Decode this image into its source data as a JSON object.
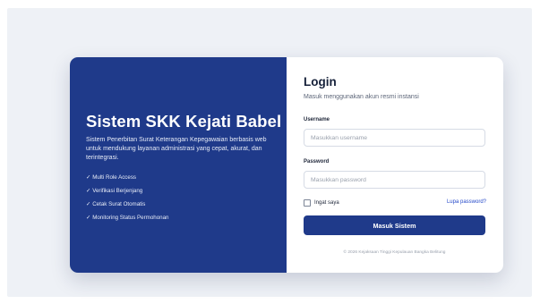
{
  "brand": {
    "title": "Sistem SKK Kejati Babel",
    "description": "Sistem Penerbitan Surat Keterangan Kepegawaian berbasis web untuk mendukung layanan administrasi yang cepat, akurat, dan terintegrasi.",
    "features": [
      "Multi Role Access",
      "Verifikasi Berjenjang",
      "Cetak Surat Otomatis",
      "Monitoring Status Permohonan"
    ],
    "check_glyph": "✓"
  },
  "login": {
    "title": "Login",
    "subtitle": "Masuk menggunakan akun resmi instansi",
    "username_label": "Username",
    "username_placeholder": "Masukkan username",
    "username_value": "",
    "password_label": "Password",
    "password_placeholder": "Masukkan password",
    "password_value": "",
    "remember_label": "Ingat saya",
    "remember_checked": false,
    "forgot_label": "Lupa password?",
    "submit_label": "Masuk Sistem",
    "footer": "© 2026 Kejaksaan Tinggi Kepulauan Bangka Belitung"
  },
  "colors": {
    "brand_panel": "#1f3a8a",
    "button": "#1f3a8a",
    "link": "#2449c9",
    "page_background": "#eef1f6"
  }
}
